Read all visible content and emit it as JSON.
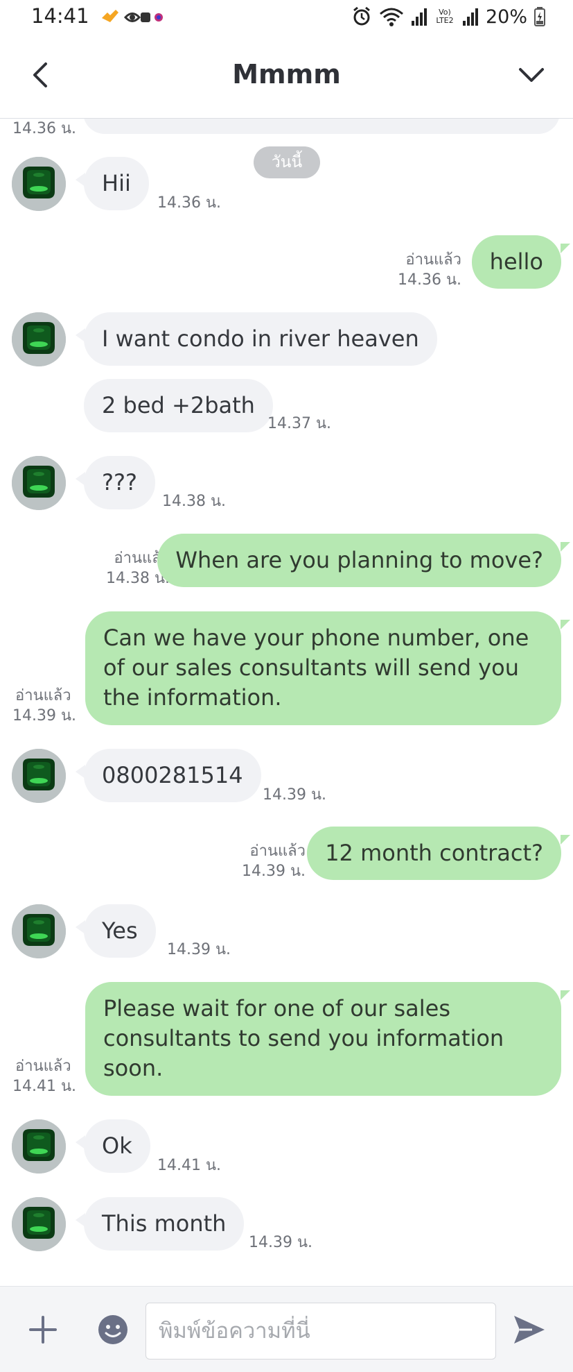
{
  "status_bar": {
    "time": "14:41",
    "network_label": "Vo) LTE2",
    "battery": "20%"
  },
  "header": {
    "title": "Mmmm"
  },
  "chat": {
    "partial_time": "14.36 น.",
    "date_chip": "วันนี้",
    "messages": [
      {
        "dir": "in",
        "avatar": true,
        "text": "Hii",
        "time": "14.36 น."
      },
      {
        "dir": "out",
        "read": "อ่านแล้ว",
        "text": "hello",
        "time": "14.36 น."
      },
      {
        "dir": "in",
        "avatar": true,
        "text": "I want condo in river heaven",
        "time": ""
      },
      {
        "dir": "in",
        "avatar": false,
        "text": "2 bed +2bath",
        "time": "14.37 น."
      },
      {
        "dir": "in",
        "avatar": true,
        "text": "???",
        "time": "14.38 น."
      },
      {
        "dir": "out",
        "read": "อ่านแล้ว",
        "text": "When are you planning to move?",
        "time": "14.38 น."
      },
      {
        "dir": "out",
        "read": "อ่านแล้ว",
        "text": "Can we have your phone number, one of our sales consultants will send you the information.",
        "time": "14.39 น."
      },
      {
        "dir": "in",
        "avatar": true,
        "text": "0800281514",
        "time": "14.39 น."
      },
      {
        "dir": "out",
        "read": "อ่านแล้ว",
        "text": "12 month contract?",
        "time": "14.39 น."
      },
      {
        "dir": "in",
        "avatar": true,
        "text": "Yes",
        "time": "14.39 น."
      },
      {
        "dir": "out",
        "read": "อ่านแล้ว",
        "text": "Please wait for one of our sales consultants to send you information soon.",
        "time": "14.41 น."
      },
      {
        "dir": "in",
        "avatar": true,
        "text": "Ok",
        "time": "14.41 น."
      },
      {
        "dir": "in",
        "avatar": true,
        "text": "This month",
        "time": "14.39 น."
      }
    ]
  },
  "input_bar": {
    "placeholder": "พิมพ์ข้อความที่นี่"
  },
  "icons": {
    "back": "chevron-left-icon",
    "menu": "chevron-down-icon",
    "add": "plus-icon",
    "emoji": "emoji-icon",
    "send": "send-icon",
    "avatar": "green-gem-avatar"
  },
  "colors": {
    "incoming_bubble": "#f1f2f5",
    "outgoing_bubble": "#b6e8b2",
    "send_icon": "#6a7086"
  }
}
